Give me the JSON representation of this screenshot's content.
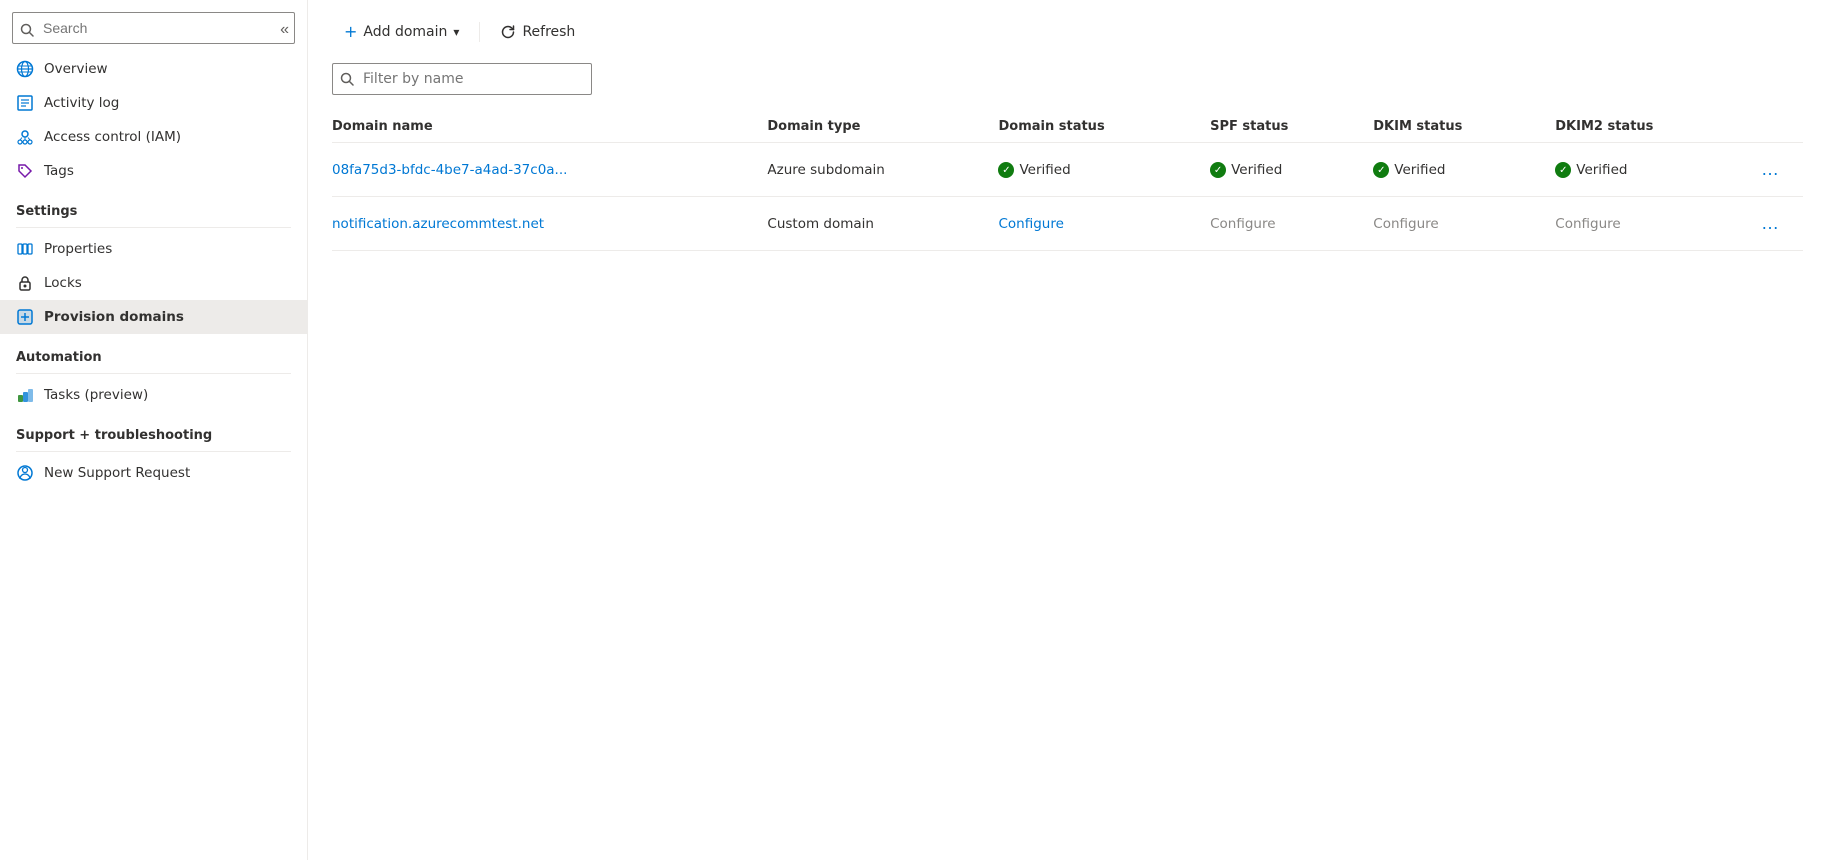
{
  "sidebar": {
    "search_placeholder": "Search",
    "collapse_title": "Collapse",
    "nav_items": [
      {
        "id": "overview",
        "label": "Overview",
        "icon": "overview-icon",
        "active": false
      },
      {
        "id": "activity-log",
        "label": "Activity log",
        "icon": "activity-icon",
        "active": false
      },
      {
        "id": "access-control",
        "label": "Access control (IAM)",
        "icon": "access-icon",
        "active": false
      },
      {
        "id": "tags",
        "label": "Tags",
        "icon": "tags-icon",
        "active": false
      }
    ],
    "sections": [
      {
        "header": "Settings",
        "items": [
          {
            "id": "properties",
            "label": "Properties",
            "icon": "properties-icon",
            "active": false
          },
          {
            "id": "locks",
            "label": "Locks",
            "icon": "locks-icon",
            "active": false
          },
          {
            "id": "provision-domains",
            "label": "Provision domains",
            "icon": "provision-icon",
            "active": true
          }
        ]
      },
      {
        "header": "Automation",
        "items": [
          {
            "id": "tasks",
            "label": "Tasks (preview)",
            "icon": "tasks-icon",
            "active": false
          }
        ]
      },
      {
        "header": "Support + troubleshooting",
        "items": [
          {
            "id": "support",
            "label": "New Support Request",
            "icon": "support-icon",
            "active": false
          }
        ]
      }
    ]
  },
  "toolbar": {
    "add_domain_label": "Add domain",
    "add_dropdown_label": "▾",
    "refresh_label": "Refresh"
  },
  "filter": {
    "placeholder": "Filter by name"
  },
  "table": {
    "columns": [
      {
        "id": "domain-name",
        "label": "Domain name"
      },
      {
        "id": "domain-type",
        "label": "Domain type"
      },
      {
        "id": "domain-status",
        "label": "Domain status"
      },
      {
        "id": "spf-status",
        "label": "SPF status"
      },
      {
        "id": "dkim-status",
        "label": "DKIM status"
      },
      {
        "id": "dkim2-status",
        "label": "DKIM2 status"
      }
    ],
    "rows": [
      {
        "domain_name": "08fa75d3-bfdc-4be7-a4ad-37c0a...",
        "domain_type": "Azure subdomain",
        "domain_status": "Verified",
        "domain_status_type": "verified",
        "spf_status": "Verified",
        "spf_status_type": "verified",
        "dkim_status": "Verified",
        "dkim_status_type": "verified",
        "dkim2_status": "Verified",
        "dkim2_status_type": "verified"
      },
      {
        "domain_name": "notification.azurecommtest.net",
        "domain_type": "Custom domain",
        "domain_status": "Configure",
        "domain_status_type": "configure",
        "spf_status": "Configure",
        "spf_status_type": "configure-grey",
        "dkim_status": "Configure",
        "dkim_status_type": "configure-grey",
        "dkim2_status": "Configure",
        "dkim2_status_type": "configure-grey"
      }
    ]
  }
}
